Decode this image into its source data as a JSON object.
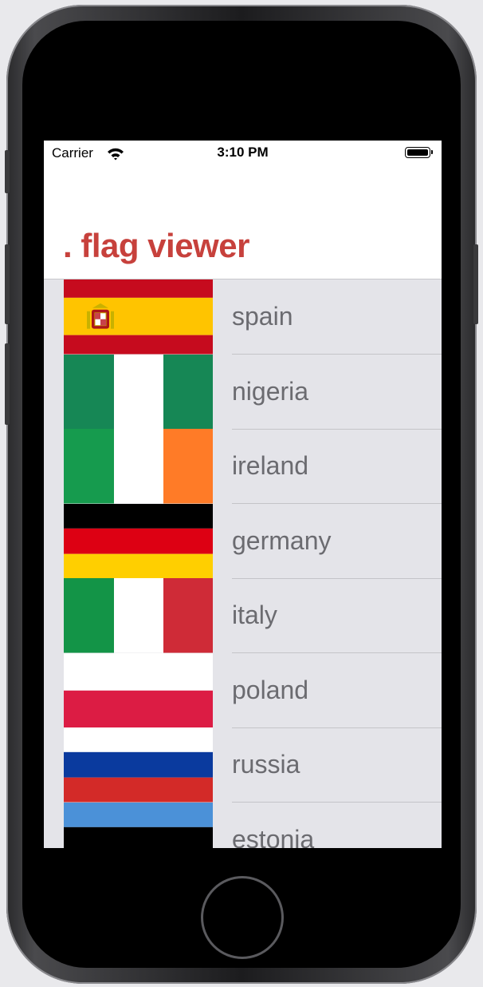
{
  "status_bar": {
    "carrier": "Carrier",
    "time": "3:10 PM",
    "battery_level": 1.0,
    "wifi_icon": "wifi-icon",
    "battery_icon": "battery-icon"
  },
  "header": {
    "title": ". flag viewer",
    "title_color": "#c7413c"
  },
  "countries": [
    {
      "name": "spain"
    },
    {
      "name": "nigeria"
    },
    {
      "name": "ireland"
    },
    {
      "name": "germany"
    },
    {
      "name": "italy"
    },
    {
      "name": "poland"
    },
    {
      "name": "russia"
    },
    {
      "name": "estonia"
    }
  ],
  "colors": {
    "list_background": "#e4e4e9",
    "row_text": "#6b6b70",
    "spain_red": "#c60b1e",
    "spain_yellow": "#ffc400",
    "nigeria_green": "#168755",
    "ireland_green": "#169b4e",
    "ireland_orange": "#ff7b27",
    "germany_red": "#dd0013",
    "germany_gold": "#ffcf00",
    "italy_green": "#139447",
    "italy_red": "#cf2b37",
    "poland_red": "#dc1c44",
    "russia_blue": "#0a3a9e",
    "russia_red": "#d32a28",
    "estonia_blue": "#4b91d8"
  }
}
